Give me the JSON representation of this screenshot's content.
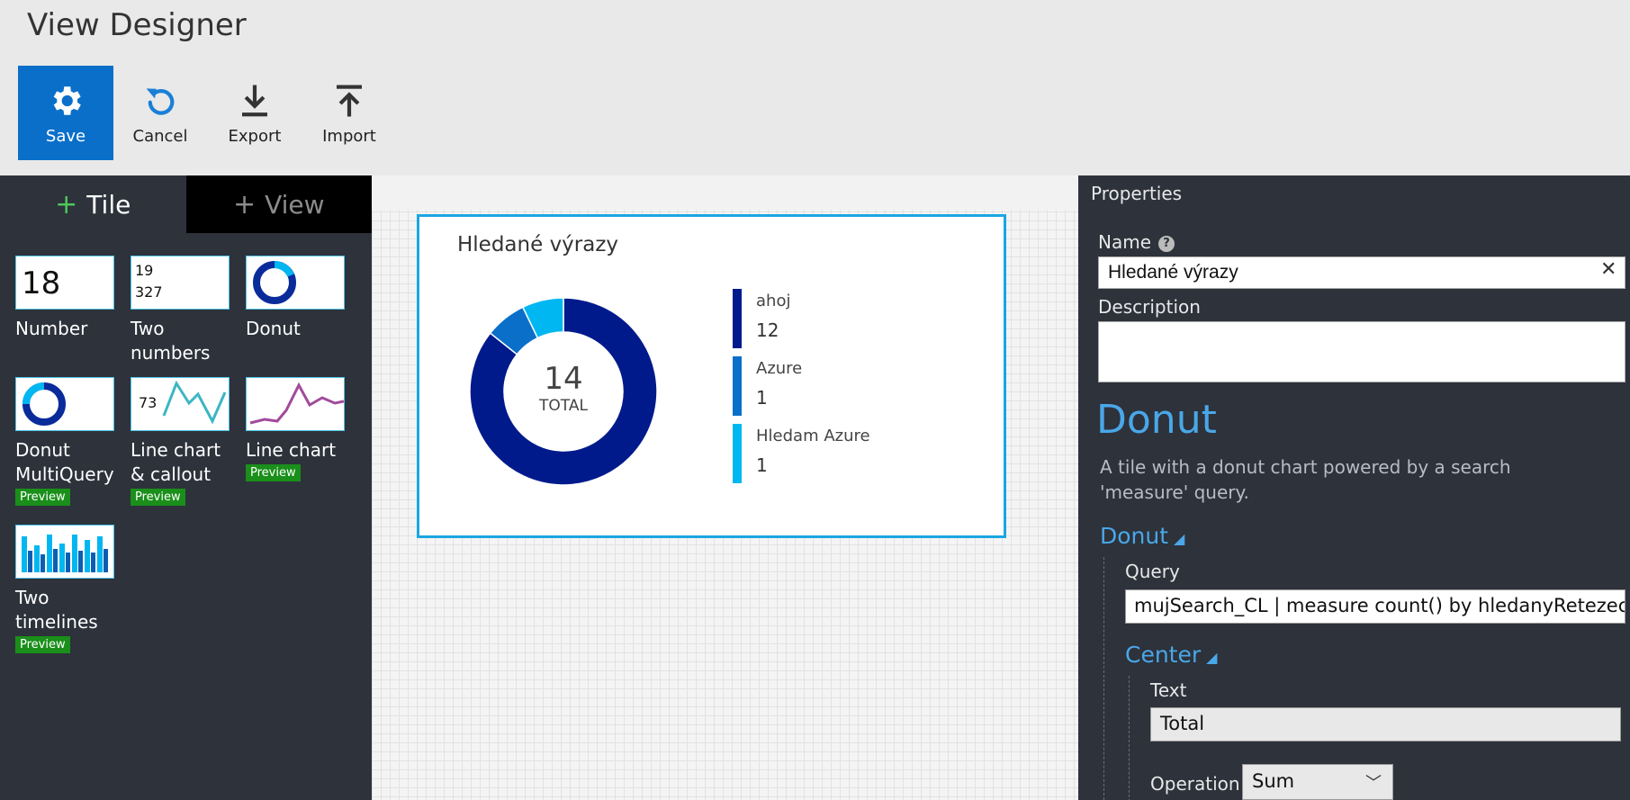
{
  "app": {
    "title": "View Designer"
  },
  "toolbar": {
    "save_label": "Save",
    "cancel_label": "Cancel",
    "export_label": "Export",
    "import_label": "Import",
    "save_icon": "gear-icon",
    "cancel_icon": "undo-icon",
    "export_icon": "download-icon",
    "import_icon": "upload-icon",
    "primary_color": "#0a6fc9"
  },
  "gallery": {
    "tabs": [
      {
        "label": "Tile",
        "icon": "plus-icon",
        "active": true
      },
      {
        "label": "View",
        "icon": "plus-icon",
        "active": false
      }
    ],
    "tiles": [
      {
        "label": "Number",
        "thumb_text": "18"
      },
      {
        "label": "Two numbers",
        "thumb_line1": "19",
        "thumb_line2": "327"
      },
      {
        "label": "Donut"
      },
      {
        "label": "Donut MultiQuery",
        "badge": "Preview"
      },
      {
        "label": "Line chart & callout",
        "badge": "Preview",
        "thumb_text": "73"
      },
      {
        "label": "Line chart",
        "badge": "Preview"
      },
      {
        "label": "Two timelines",
        "badge": "Preview"
      }
    ]
  },
  "canvas": {
    "card_title": "Hledané výrazy",
    "center_value": "14",
    "center_text": "TOTAL",
    "accent_color": "#1aa6e2"
  },
  "chart_data": {
    "type": "pie",
    "title": "Hledané výrazy",
    "categories": [
      "ahoj",
      "Azure",
      "Hledam Azure"
    ],
    "values": [
      12,
      1,
      1
    ],
    "colors": [
      "#001a8c",
      "#0a6fc9",
      "#00b7f1"
    ],
    "center_label": "TOTAL",
    "total": 14,
    "legend": "right"
  },
  "properties": {
    "header": "Properties",
    "name_label": "Name",
    "name_value": "Hledané výrazy",
    "description_label": "Description",
    "description_value": "",
    "section_title": "Donut",
    "section_description": "A tile with a donut chart powered by a search 'measure' query.",
    "donut_group_title": "Donut",
    "query_label": "Query",
    "query_value": "mujSearch_CL | measure count() by hledanyRetezec_s",
    "center_group_title": "Center",
    "text_label": "Text",
    "text_value": "Total",
    "operation_label": "Operation",
    "operation_value": "Sum",
    "heading_color": "#4aa7e8"
  }
}
